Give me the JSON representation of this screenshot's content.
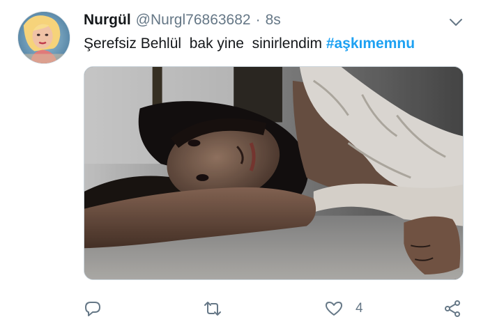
{
  "tweet": {
    "display_name": "Nurgül",
    "handle": "@Nurgl76863682",
    "separator": "·",
    "time": "8s",
    "text_plain": "Şerefsiz Behlül  bak yine  sinirlendim ",
    "hashtag": "#aşkımemnu",
    "media": {
      "kind": "photo"
    },
    "actions": {
      "reply_icon": "reply-icon",
      "retweet_icon": "retweet-icon",
      "like_icon": "heart-icon",
      "share_icon": "share-icon",
      "like_count": "4"
    },
    "menu_icon": "chevron-down-icon"
  },
  "colors": {
    "text": "#14171a",
    "secondary": "#657786",
    "link": "#1da1f2",
    "border": "#ccd6dd"
  }
}
